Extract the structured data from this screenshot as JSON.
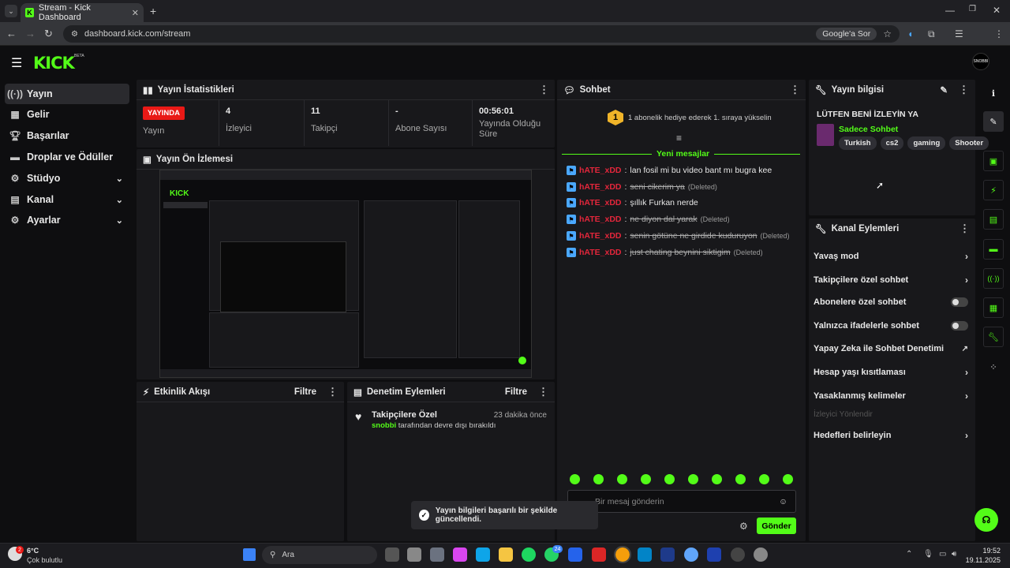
{
  "browser": {
    "tab_title": "Stream - Kick Dashboard",
    "url": "dashboard.kick.com/stream",
    "google_lens": "Google'a Sor"
  },
  "app": {
    "logo": "KICK",
    "beta": "BETA",
    "avatar_text": "SNOBBI"
  },
  "sidebar": {
    "items": [
      {
        "label": "Yayın",
        "icon": "broadcast-icon"
      },
      {
        "label": "Gelir",
        "icon": "revenue-icon"
      },
      {
        "label": "Başarılar",
        "icon": "trophy-icon"
      },
      {
        "label": "Droplar ve Ödüller",
        "icon": "drops-icon"
      },
      {
        "label": "Stüdyo",
        "icon": "studio-icon"
      },
      {
        "label": "Kanal",
        "icon": "channel-icon"
      },
      {
        "label": "Ayarlar",
        "icon": "settings-icon"
      }
    ]
  },
  "stats": {
    "title": "Yayın İstatistikleri",
    "live_badge": "YAYINDA",
    "stream_label": "Yayın",
    "viewers_value": "4",
    "viewers_label": "İzleyici",
    "followers_value": "11",
    "followers_label": "Takipçi",
    "subs_value": "-",
    "subs_label": "Abone Sayısı",
    "duration_value": "00:56:01",
    "duration_label": "Yayında Olduğu Süre"
  },
  "preview": {
    "title": "Yayın Ön İzlemesi"
  },
  "activity": {
    "title": "Etkinlik Akışı",
    "filter": "Filtre"
  },
  "moderation": {
    "title": "Denetim Eylemleri",
    "filter": "Filtre",
    "entry_title": "Takipçilere Özel",
    "entry_time": "23 dakika önce",
    "entry_user": "snobbi",
    "entry_text": "tarafından devre dışı bırakıldı"
  },
  "chat": {
    "title": "Sohbet",
    "gift_rank": "1",
    "gift_text": "1 abonelik hediye ederek 1. sıraya yükselin",
    "new_messages": "Yeni mesajlar",
    "messages": [
      {
        "user": "hATE_xDD",
        "text": "lan fosil mi bu video bant mı bugra kee",
        "deleted": false
      },
      {
        "user": "hATE_xDD",
        "text": "seni cikerim ya",
        "deleted": true
      },
      {
        "user": "hATE_xDD",
        "text": "şıllık Furkan nerde",
        "deleted": false
      },
      {
        "user": "hATE_xDD",
        "text": "ne diyon dal yarak",
        "deleted": true
      },
      {
        "user": "hATE_xDD",
        "text": "senin götüne ne girdide kuduruyon",
        "deleted": true
      },
      {
        "user": "hATE_xDD",
        "text": "just chating beynini siktigim",
        "deleted": true
      }
    ],
    "deleted_tag": "(Deleted)",
    "placeholder": "Bir mesaj gönderin",
    "send": "Gönder"
  },
  "stream_info": {
    "title": "Yayın bilgisi",
    "stream_title": "LÜTFEN BENİ İZLEYİN YA",
    "category": "Sadece Sohbet",
    "tags": [
      "Turkish",
      "cs2",
      "gaming",
      "Shooter"
    ]
  },
  "channel_actions": {
    "title": "Kanal Eylemleri",
    "items": [
      {
        "label": "Yavaş mod",
        "control": "arrow"
      },
      {
        "label": "Takipçilere özel sohbet",
        "control": "arrow"
      },
      {
        "label": "Abonelere özel sohbet",
        "control": "toggle"
      },
      {
        "label": "Yalnızca ifadelerle sohbet",
        "control": "toggle"
      },
      {
        "label": "Yapay Zeka ile Sohbet Denetimi",
        "control": "external"
      },
      {
        "label": "Hesap yaşı kısıtlaması",
        "control": "arrow"
      },
      {
        "label": "Yasaklanmış kelimeler",
        "control": "arrow"
      },
      {
        "label": "İzleyici Yönlendir",
        "control": "disabled"
      },
      {
        "label": "Hedefleri belirleyin",
        "control": "arrow"
      }
    ]
  },
  "toast": {
    "text": "Yayın bilgileri başarılı bir şekilde güncellendi."
  },
  "taskbar": {
    "weather_temp": "6°C",
    "weather_desc": "Çok bulutlu",
    "weather_badge": "2",
    "search": "Ara",
    "whatsapp_badge": "24",
    "time": "19:52",
    "date": "19.11.2025"
  },
  "colors": {
    "accent": "#53fc18",
    "live": "#e91916",
    "user": "#e3263b"
  }
}
